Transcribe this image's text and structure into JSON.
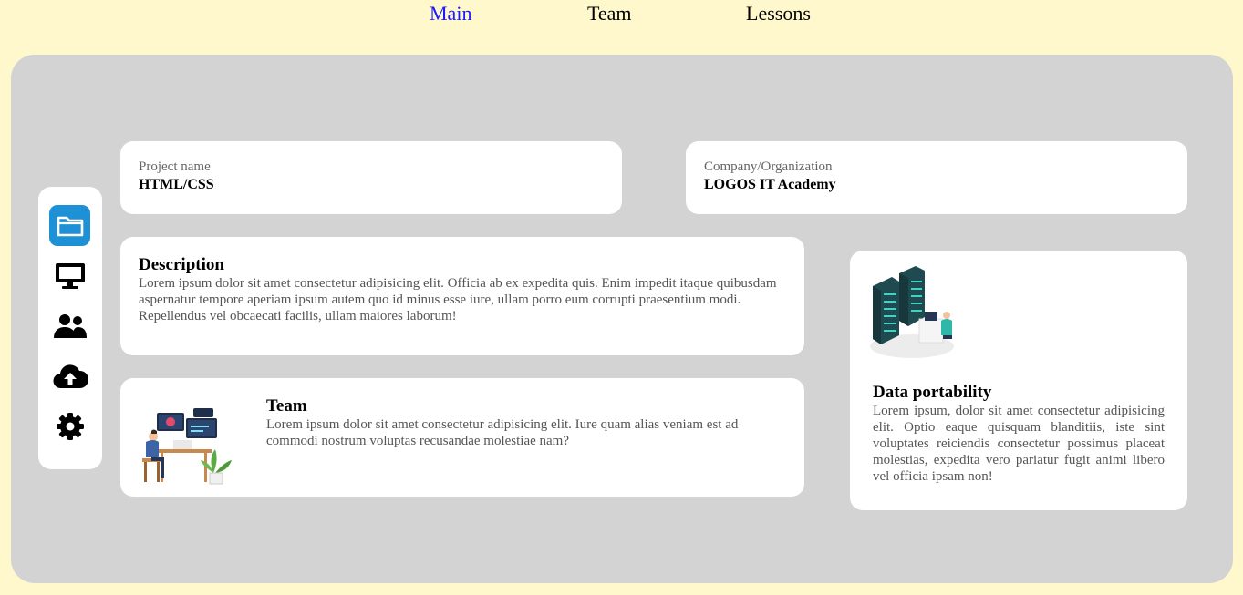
{
  "nav": {
    "items": [
      {
        "label": "Main",
        "active": true
      },
      {
        "label": "Team",
        "active": false
      },
      {
        "label": "Lessons",
        "active": false
      }
    ]
  },
  "sidebar": {
    "items": [
      {
        "icon": "folder-icon",
        "active": true
      },
      {
        "icon": "monitor-icon",
        "active": false
      },
      {
        "icon": "users-icon",
        "active": false
      },
      {
        "icon": "cloud-upload-icon",
        "active": false
      },
      {
        "icon": "gear-icon",
        "active": false
      }
    ]
  },
  "project": {
    "label": "Project name",
    "value": "HTML/CSS"
  },
  "company": {
    "label": "Company/Organization",
    "value": "LOGOS IT Academy"
  },
  "description": {
    "title": "Description",
    "text": "Lorem ipsum dolor sit amet consectetur adipisicing elit. Officia ab ex expedita quis. Enim impedit itaque quibusdam aspernatur tempore aperiam ipsum autem quo id minus esse iure, ullam porro eum corrupti praesentium modi. Repellendus vel obcaecati facilis, ullam maiores laborum!"
  },
  "team": {
    "title": "Team",
    "text": "Lorem ipsum dolor sit amet consectetur adipisicing elit. Iure quam alias veniam est ad commodi nostrum voluptas recusandae molestiae nam?"
  },
  "data": {
    "title": "Data portability",
    "text": "Lorem ipsum, dolor sit amet consectetur adipisicing elit. Optio eaque quisquam blanditiis, iste sint voluptates reiciendis consectetur possimus placeat molestias, expedita vero pariatur fugit animi libero vel officia ipsam non!"
  },
  "colors": {
    "background": "#fff8cc",
    "panel": "#d3d3d3",
    "accent": "#1e90d6",
    "active_link": "#1a1aff"
  }
}
